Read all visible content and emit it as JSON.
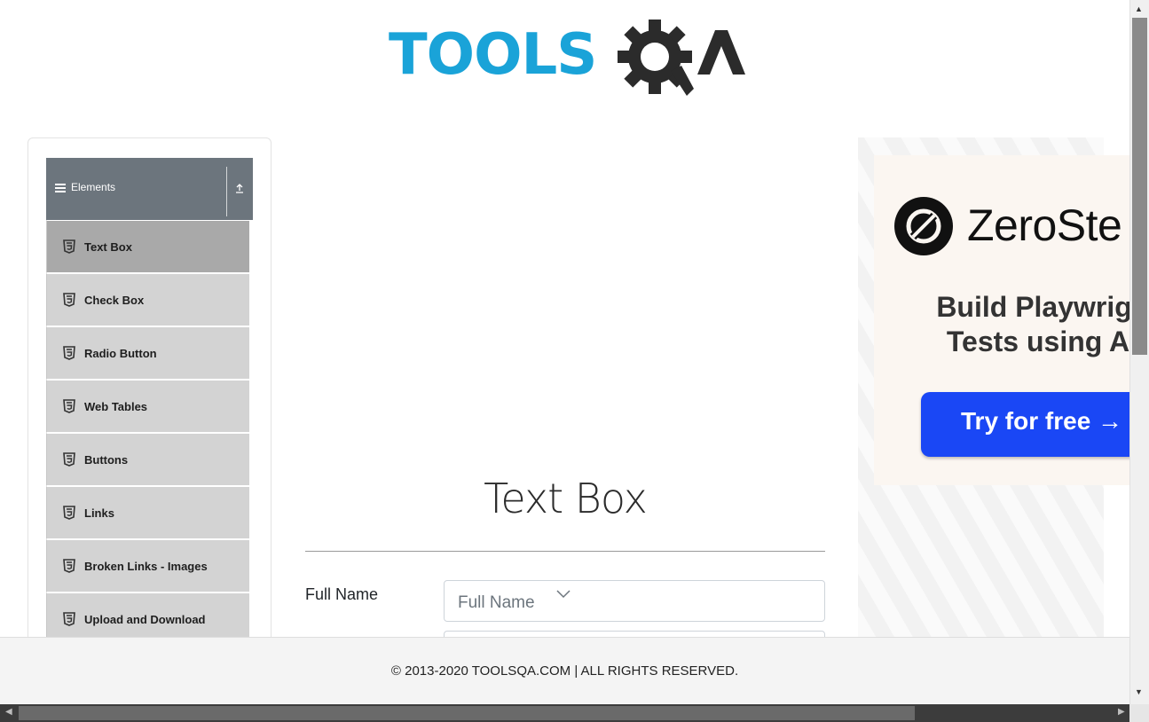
{
  "header": {
    "logo_text": "TOOLSQA",
    "logo_part_tools": "TOOLS",
    "logo_part_qa": "QA"
  },
  "sidebar": {
    "group_title": "Elements",
    "items": [
      {
        "label": "Text Box",
        "active": true
      },
      {
        "label": "Check Box",
        "active": false
      },
      {
        "label": "Radio Button",
        "active": false
      },
      {
        "label": "Web Tables",
        "active": false
      },
      {
        "label": "Buttons",
        "active": false
      },
      {
        "label": "Links",
        "active": false
      },
      {
        "label": "Broken Links - Images",
        "active": false
      },
      {
        "label": "Upload and Download",
        "active": false
      }
    ]
  },
  "main": {
    "title": "Text Box",
    "full_name_label": "Full Name",
    "full_name_placeholder": "Full Name"
  },
  "ad": {
    "brand": "ZeroSte",
    "headline_line1": "Build Playwrigl",
    "headline_line2": "Tests using A",
    "cta": "Try for free →"
  },
  "footer": {
    "copyright": "© 2013-2020 TOOLSQA.COM | ALL RIGHTS RESERVED."
  },
  "colors": {
    "logo_blue": "#1aa3d8",
    "logo_dark": "#2b2b2b",
    "group_header_bg": "#6c757d",
    "menu_item_bg": "#d3d3d3",
    "menu_item_active_bg": "#a9a9a9",
    "ad_cta_bg": "#1a47f5"
  }
}
